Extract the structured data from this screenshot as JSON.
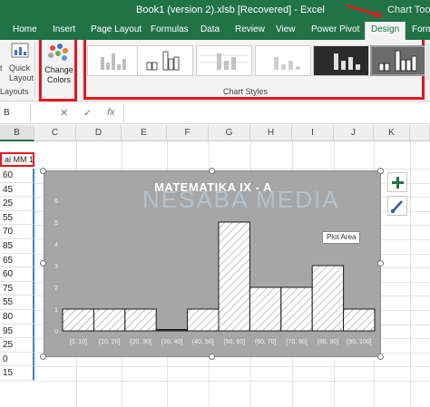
{
  "window": {
    "title": "Book1 (version 2).xlsb [Recovered] - Excel",
    "context_tab": "Chart Tools"
  },
  "tabs": [
    {
      "label": "Home"
    },
    {
      "label": "Insert"
    },
    {
      "label": "Page Layout"
    },
    {
      "label": "Formulas"
    },
    {
      "label": "Data"
    },
    {
      "label": "Review"
    },
    {
      "label": "View"
    },
    {
      "label": "Power Pivot"
    },
    {
      "label": "Design",
      "active": true
    },
    {
      "label": "Form"
    }
  ],
  "ribbon": {
    "add_element_label": "t",
    "quick_layout_label": "Quick Layout",
    "layouts_group_label": "Layouts",
    "change_colors_label": "Change Colors",
    "chart_styles_group_label": "Chart Styles",
    "accent_color": "#e8141c",
    "palette_colors": [
      "#e5493a",
      "#4472c4",
      "#ed7d31",
      "#a5a5a5",
      "#70ad47",
      "#5b9bd5"
    ]
  },
  "formula_bar": {
    "name_box": "B",
    "cancel_glyph": "✕",
    "enter_glyph": "✓",
    "fx_label": "fx"
  },
  "grid": {
    "columns": [
      "B",
      "C",
      "D",
      "E",
      "F",
      "G",
      "H",
      "I",
      "J",
      "K"
    ],
    "b_header_cell": "ai MM 1",
    "b_values": [
      "60",
      "45",
      "25",
      "55",
      "70",
      "85",
      "65",
      "60",
      "75",
      "55",
      "80",
      "95",
      "25",
      "0",
      "15"
    ]
  },
  "chart": {
    "tooltip": "Plot Area",
    "watermark": "NESABA MEDIA"
  },
  "chart_data": {
    "type": "bar",
    "title": "MATEMATIKA IX - A",
    "categories": [
      "[0, 10]",
      "(10, 20]",
      "(20, 30]",
      "(30, 40]",
      "(40, 50]",
      "(50, 60]",
      "(60, 70]",
      "(70, 80]",
      "(80, 90]",
      "(90, 100]"
    ],
    "values": [
      1,
      1,
      1,
      0,
      1,
      5,
      2,
      2,
      3,
      1
    ],
    "ylim": [
      0,
      6
    ],
    "yticks": [
      "0",
      "1",
      "2",
      "3",
      "4",
      "5",
      "6"
    ],
    "xlabel": "",
    "ylabel": "",
    "grid": false,
    "legend": "none",
    "bar_fill": "hatched-white",
    "background_color": "#a6a6a6"
  }
}
